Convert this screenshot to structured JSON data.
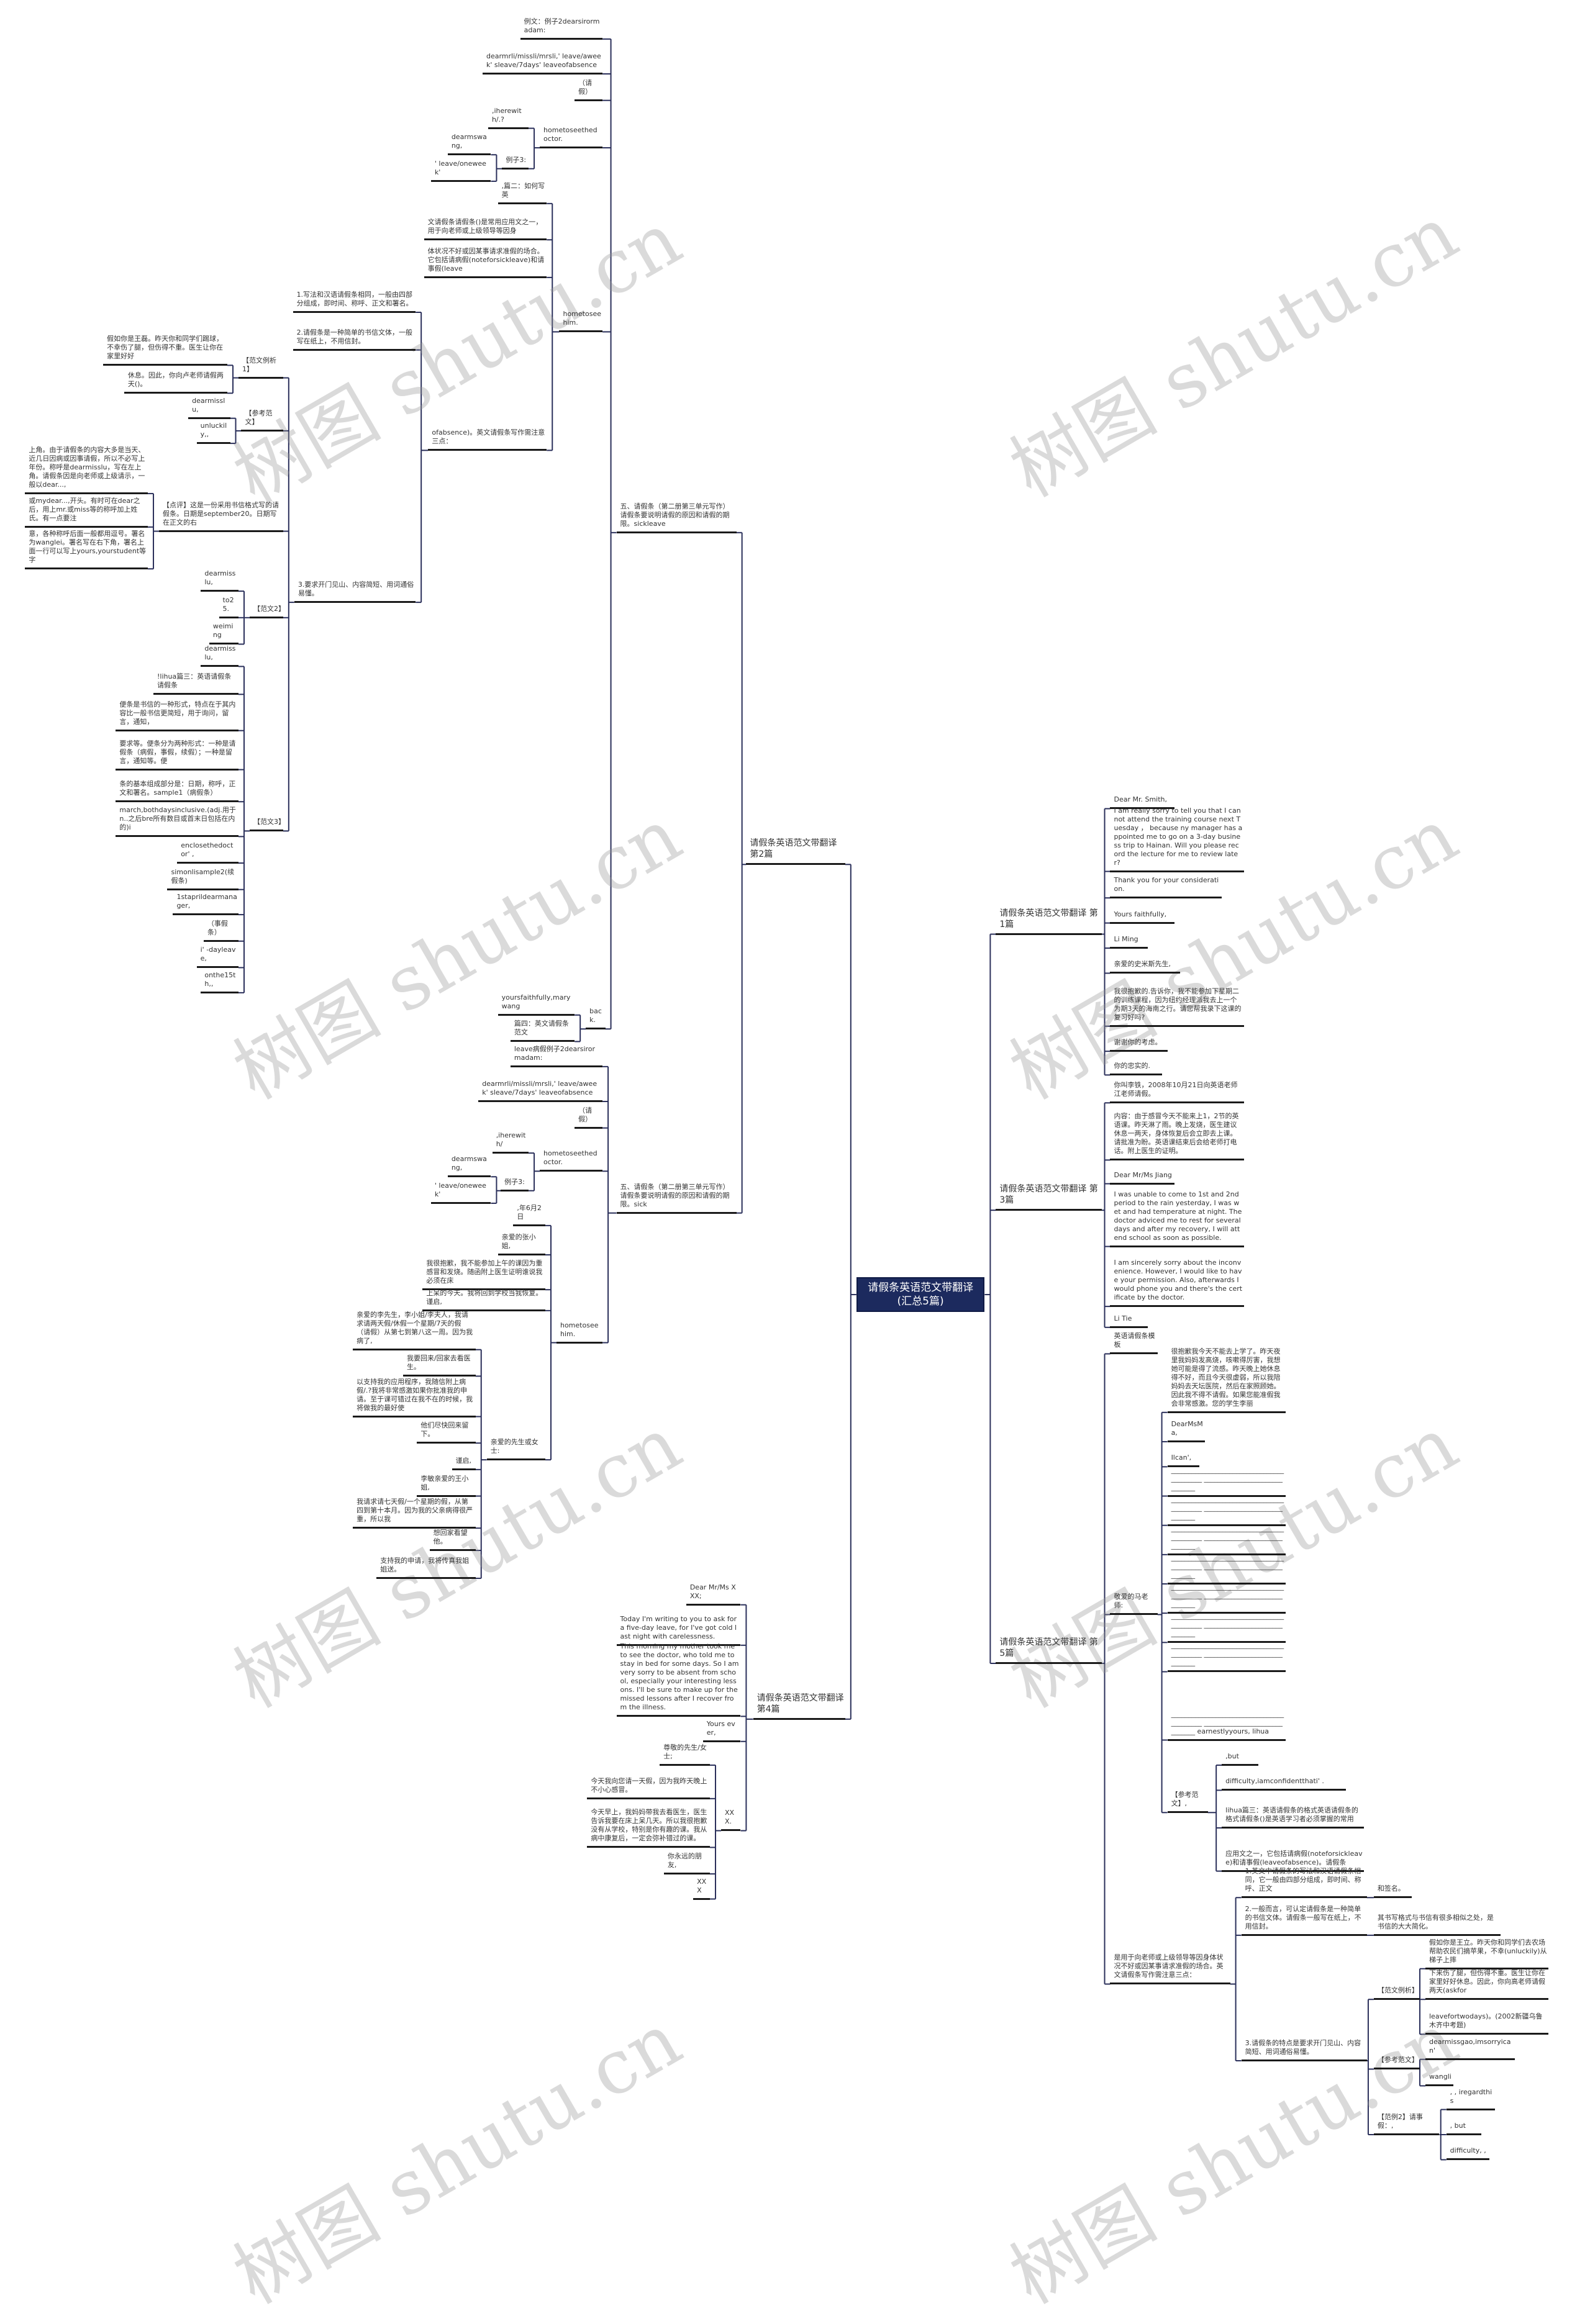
{
  "title": "请假条英语范文带翻译(汇总5篇)",
  "watermark": "树图 shutu.cn",
  "colors": {
    "root_bg": "#1c2a5e",
    "root_text": "#ffffff",
    "line": "#1a1a1a",
    "connector": "#2a2f5a"
  },
  "nodes": [
    {
      "text": "请假条英语范文带翻译(汇总5篇)",
      "parent": null
    },
    {
      "text": "请假条英语范文带翻译 第1篇",
      "parent": 0
    },
    {
      "text": "Dear Mr. Smith,",
      "parent": 1
    },
    {
      "text": "I am really sorry to tell you that I cannot attend the training course next Tuesday ， because ny manager has appointed me to go on a 3-day business trip to Hainan. Will you please record the lecture for me to review later?",
      "parent": 1
    },
    {
      "text": "Thank you for your consideration.",
      "parent": 1
    },
    {
      "text": "Yours faithfully,",
      "parent": 1
    },
    {
      "text": "Li Ming",
      "parent": 1
    },
    {
      "text": "亲爱的史米斯先生,",
      "parent": 1
    },
    {
      "text": "我很抱歉的.告诉你，我不能参加下星期二的训练课程，因为纽约经理派我去上一个为期3天的海南之行。请您帮我录下这课的复习好吗?",
      "parent": 1
    },
    {
      "text": "谢谢你的考虑。",
      "parent": 1
    },
    {
      "text": "你的忠实的.",
      "parent": 1
    },
    {
      "text": "请假条英语范文带翻译 第3篇",
      "parent": 0
    },
    {
      "text": "你叫李铁，2008年10月21日向英语老师江老师请假。",
      "parent": 11
    },
    {
      "text": "内容：由于感冒今天不能来上1，2节的英语课。昨天淋了雨。晚上发烧，医生建议休息一两天，身体恢复后会立即去上课。请批准为盼。英语课结束后会给老师打电话。附上医生的证明。",
      "parent": 11
    },
    {
      "text": "Dear Mr/Ms Jiang",
      "parent": 11
    },
    {
      "text": "I was unable to come to 1st and 2nd period to the rain yesterday, I was wet and had temperature at night. The doctor adviced me to rest for several days and after my recovery, I will attend school as soon as possible.",
      "parent": 11
    },
    {
      "text": "I am sincerely sorry about the inconvenience. However, I would like to have your permission. Also, afterwards I would phone you and there's the certificate by the doctor.",
      "parent": 11
    },
    {
      "text": "Li Tie",
      "parent": 11
    },
    {
      "text": "请假条英语范文带翻译 第5篇",
      "parent": 0
    },
    {
      "text": "英语请假条模板",
      "parent": 18
    },
    {
      "text": "敬爱的马老师:",
      "parent": 18
    },
    {
      "text": "很抱歉我今天不能去上学了。昨天夜里我妈妈发高烧，咳嗽得厉害，我想她可能是得了流感。昨天晚上她休息得不好，而且今天很虚弱，所以我陪妈妈去天坛医院，然后在家照顾她。因此我不得不请假。如果您能准假我会非常感激。您的学生李丽",
      "parent": 20
    },
    {
      "text": "DearMsMa,",
      "parent": 20
    },
    {
      "text": "Ilcan',",
      "parent": 20
    },
    {
      "text": "__________________________________________ ______________________________",
      "parent": 20
    },
    {
      "text": "__________________________________________ ______________________________",
      "parent": 20
    },
    {
      "text": "__________________________________________ ______________________________",
      "parent": 20
    },
    {
      "text": "__________________________________________ ______________________________",
      "parent": 20
    },
    {
      "text": "__________________________________________ ______________________________",
      "parent": 20
    },
    {
      "text": "__________________________________________ ______________________________",
      "parent": 20
    },
    {
      "text": "__________________________________________ ______________________________",
      "parent": 20
    },
    {
      "text": "__________________________________________ ______________________________ earnestlyyours, lihua",
      "parent": 20
    },
    {
      "text": "【参考范文】,",
      "parent": 20
    },
    {
      "text": ",but",
      "parent": 32
    },
    {
      "text": "difficulty,iamconfidentthati' .",
      "parent": 32
    },
    {
      "text": "lihua篇三：英语请假条的格式英语请假条的格式请假条()是英语学习者必须掌握的常用",
      "parent": 32
    },
    {
      "text": "应用文之一，它包括请病假(noteforsickleave)和请事假(leaveofabsence)。请假条",
      "parent": 32
    },
    {
      "text": "是用于向老师或上级领导等因身体状况不好或因某事请求准假的场合。英文请假条写作需注意三点：",
      "parent": 18
    },
    {
      "text": "1.英文中请假条的写法和汉语请假条相同，它一般由四部分组成，即时间、称呼、正文",
      "parent": 37
    },
    {
      "text": "和签名。",
      "parent": 38
    },
    {
      "text": "2.一般而言，可认定请假条是一种简单的书信文体。请假条一般写在纸上，不用信封。",
      "parent": 37
    },
    {
      "text": "其书写格式与书信有很多相似之处，是书信的大大简化。",
      "parent": 40
    },
    {
      "text": "3.请假条的特点是要求开门见山、内容简短、用词通俗易懂。",
      "parent": 37
    },
    {
      "text": "【范文例析】",
      "parent": 42
    },
    {
      "text": "假如你是王立。昨天你和同学们去农场帮助农民们摘苹果，不幸(unluckily)从梯子上摔",
      "parent": 43
    },
    {
      "text": "下来伤了腿，但伤得不重。医生让你在家里好好休息。因此，你向高老师请假两天(askfor",
      "parent": 43
    },
    {
      "text": "leavefortwodays)。(2002新疆乌鲁木齐中考题)",
      "parent": 43
    },
    {
      "text": "【参考范文】",
      "parent": 42
    },
    {
      "text": "dearmissgao,imsorryican'",
      "parent": 47
    },
    {
      "text": "wangli",
      "parent": 47
    },
    {
      "text": "【范例2】请事假：,",
      "parent": 42
    },
    {
      "text": ", , iregardthis",
      "parent": 50
    },
    {
      "text": ", but",
      "parent": 50
    },
    {
      "text": "difficulty, ,",
      "parent": 50
    },
    {
      "text": "请假条英语范文带翻译 第2篇",
      "parent": 0
    },
    {
      "text": "五、请假条（第二册第三单元写作）请假条要说明请假的原因和请假的期限。sickleave",
      "parent": 54
    },
    {
      "text": "例文：例子2dearsirormadam:",
      "parent": 55
    },
    {
      "text": "dearmrli/missli/mrsli,' leave/aweek' sleave/7days' leaveofabsence",
      "parent": 55
    },
    {
      "text": "（请假）",
      "parent": 55
    },
    {
      "text": "hometoseethedoctor.",
      "parent": 55
    },
    {
      "text": ",iherewith/.?",
      "parent": 59
    },
    {
      "text": "例子3:",
      "parent": 59
    },
    {
      "text": "dearmswang,",
      "parent": 61
    },
    {
      "text": "' leave/oneweek'",
      "parent": 61
    },
    {
      "text": "hometoseehim.",
      "parent": 55
    },
    {
      "text": ",篇二：如何写英",
      "parent": 64
    },
    {
      "text": "文请假条请假条()是常用应用文之一，用于向老师或上级领导等因身",
      "parent": 64
    },
    {
      "text": "体状况不好或因某事请求准假的场合。它包括请病假(noteforsickleave)和请事假(leave",
      "parent": 64
    },
    {
      "text": "ofabsence)。英文请假条写作需注意三点：",
      "parent": 64
    },
    {
      "text": "1.写法和汉语请假条相同，一般由四部分组成，即时间、称呼、正文和署名。",
      "parent": 68
    },
    {
      "text": "2.请假条是一种简单的书信文体，一般写在纸上，不用信封。",
      "parent": 68
    },
    {
      "text": "3.要求开门见山、内容简短、用词通俗易懂。",
      "parent": 68
    },
    {
      "text": "【范文例析1】",
      "parent": 71
    },
    {
      "text": "假如你是王磊。昨天你和同学们踢球，不幸伤了腿，但伤得不重。医生让你在家里好好",
      "parent": 72
    },
    {
      "text": "休息。因此，你向卢老师请假两天()。",
      "parent": 72
    },
    {
      "text": "【参考范文】",
      "parent": 71
    },
    {
      "text": "dearmisslu,",
      "parent": 75
    },
    {
      "text": "unluckily,,",
      "parent": 75
    },
    {
      "text": "【点评】这是一份采用书信格式写的请假条。日期是september20。日期写在正文的右",
      "parent": 71
    },
    {
      "text": "上角。由于请假条的内容大多是当天、近几日因病或因事请假，所以不必写上年份。称呼是dearmisslu，写在左上角。请假条因是向老师或上级请示，一般以dear...,",
      "parent": 78
    },
    {
      "text": "或mydear...,开头。有时可在dear之后，用上mr.或miss等的称呼加上姓氏。有一点要注",
      "parent": 78
    },
    {
      "text": "意，各种称呼后面一般都用逗号。署名为wanglei。署名写在右下角，署名上面一行可以写上yours,yourstudent等字",
      "parent": 78
    },
    {
      "text": "【范文2】",
      "parent": 71
    },
    {
      "text": "dearmisslu,",
      "parent": 82
    },
    {
      "text": "to25.",
      "parent": 82
    },
    {
      "text": "weiming",
      "parent": 82
    },
    {
      "text": "【范文3】",
      "parent": 71
    },
    {
      "text": "dearmisslu,",
      "parent": 86
    },
    {
      "text": "!lihua篇三：英语请假条请假条",
      "parent": 86
    },
    {
      "text": "便条是书信的一种形式，特点在于其内容比一般书信更简短，用于询问，留言，通知，",
      "parent": 86
    },
    {
      "text": "要求等。便条分为两种形式：一种是请假条（病假，事假，续假）；一种是留言，通知等。便",
      "parent": 86
    },
    {
      "text": "条的基本组成部分是：日期，称呼，正文和署名。sample1（病假条）",
      "parent": 86
    },
    {
      "text": "march,bothdaysinclusive.(adj.用于n..之后bre所有数目或首末日包括在内的)i",
      "parent": 86
    },
    {
      "text": "enclosethedoctor' ,",
      "parent": 86
    },
    {
      "text": "simonlisample2(续假条)",
      "parent": 86
    },
    {
      "text": "1staprildearmanager,",
      "parent": 86
    },
    {
      "text": "（事假条）",
      "parent": 86
    },
    {
      "text": "i' -dayleave,",
      "parent": 86
    },
    {
      "text": "onthe15th,,",
      "parent": 86
    },
    {
      "text": "back.",
      "parent": 55
    },
    {
      "text": "yoursfaithfully,marywang",
      "parent": 99
    },
    {
      "text": "篇四：英文请假条范文",
      "parent": 99
    },
    {
      "text": "五、请假条（第二册第三单元写作）请假条要说明请假的原因和请假的期限。sick",
      "parent": 54
    },
    {
      "text": "leave病假例子2dearsirormadam:",
      "parent": 102
    },
    {
      "text": "dearmrli/missli/mrsli,' leave/aweek' sleave/7days' leaveofabsence",
      "parent": 102
    },
    {
      "text": "（请假）",
      "parent": 102
    },
    {
      "text": "hometoseethedoctor.",
      "parent": 102
    },
    {
      "text": ",iherewith/",
      "parent": 106
    },
    {
      "text": "例子3:",
      "parent": 106
    },
    {
      "text": "dearmswang,",
      "parent": 108
    },
    {
      "text": "' leave/oneweek'",
      "parent": 108
    },
    {
      "text": "hometoseehim.",
      "parent": 102
    },
    {
      "text": ",年6月2日",
      "parent": 111
    },
    {
      "text": "亲爱的张小姐,",
      "parent": 111
    },
    {
      "text": "我很抱歉，我不能参加上午的课因为重感冒和发烧。随函附上医生证明谁说我必须在床",
      "parent": 111
    },
    {
      "text": "上呆的今天。我将回到学校当我恢复。谨启,",
      "parent": 111
    },
    {
      "text": "亲爱的先生或女士:",
      "parent": 111
    },
    {
      "text": "亲爱的李先生，李小姐/李夫人，我请求请两天假/休假一个星期/7天的假（请假）从第七到第八这一周。因为我病了,",
      "parent": 116
    },
    {
      "text": "我要回来/回家去看医生。",
      "parent": 116
    },
    {
      "text": "以支持我的应用程序，我随信附上病假/.?我将非常感激如果你批准我的申请。至于课可错过在我不在的时候，我将做我的最好使",
      "parent": 116
    },
    {
      "text": "他们尽快回来留下。",
      "parent": 116
    },
    {
      "text": "谨启,",
      "parent": 116
    },
    {
      "text": "李敏亲爱的王小姐,",
      "parent": 116
    },
    {
      "text": "我请求请七天假/一个星期的假，从第四到第十本月。因为我的父亲病得很严重，所以我",
      "parent": 116
    },
    {
      "text": "想回家看望他。",
      "parent": 116
    },
    {
      "text": "支持我的申请，我将传真我姐姐送。",
      "parent": 116
    },
    {
      "text": "请假条英语范文带翻译 第4篇",
      "parent": 0
    },
    {
      "text": "Dear Mr/Ms XXX;",
      "parent": 126
    },
    {
      "text": "Today I'm writing to you to ask for a five-day leave, for I've got cold last night with carelessness.",
      "parent": 126
    },
    {
      "text": "This morning my mother took me to see the doctor, who told me to stay in bed for some days. So I am very sorry to be absent from school, especially your interesting lessons. I'll be sure to make up for the missed lessons after I recover from the illness.",
      "parent": 126
    },
    {
      "text": "Yours ever,",
      "parent": 126
    },
    {
      "text": "XXX.",
      "parent": 126
    },
    {
      "text": "尊敬的先生/女士;",
      "parent": 131
    },
    {
      "text": "今天我向您请一天假，因为我昨天晚上不小心感冒。",
      "parent": 131
    },
    {
      "text": "今天早上，我妈妈带我去看医生，医生告诉我要在床上呆几天。所以我很抱歉没有从学校，特别是你有趣的课。我从病中康复后，一定会弥补错过的课。",
      "parent": 131
    },
    {
      "text": "你永远的朋友,",
      "parent": 131
    },
    {
      "text": "XXX",
      "parent": 131
    }
  ]
}
